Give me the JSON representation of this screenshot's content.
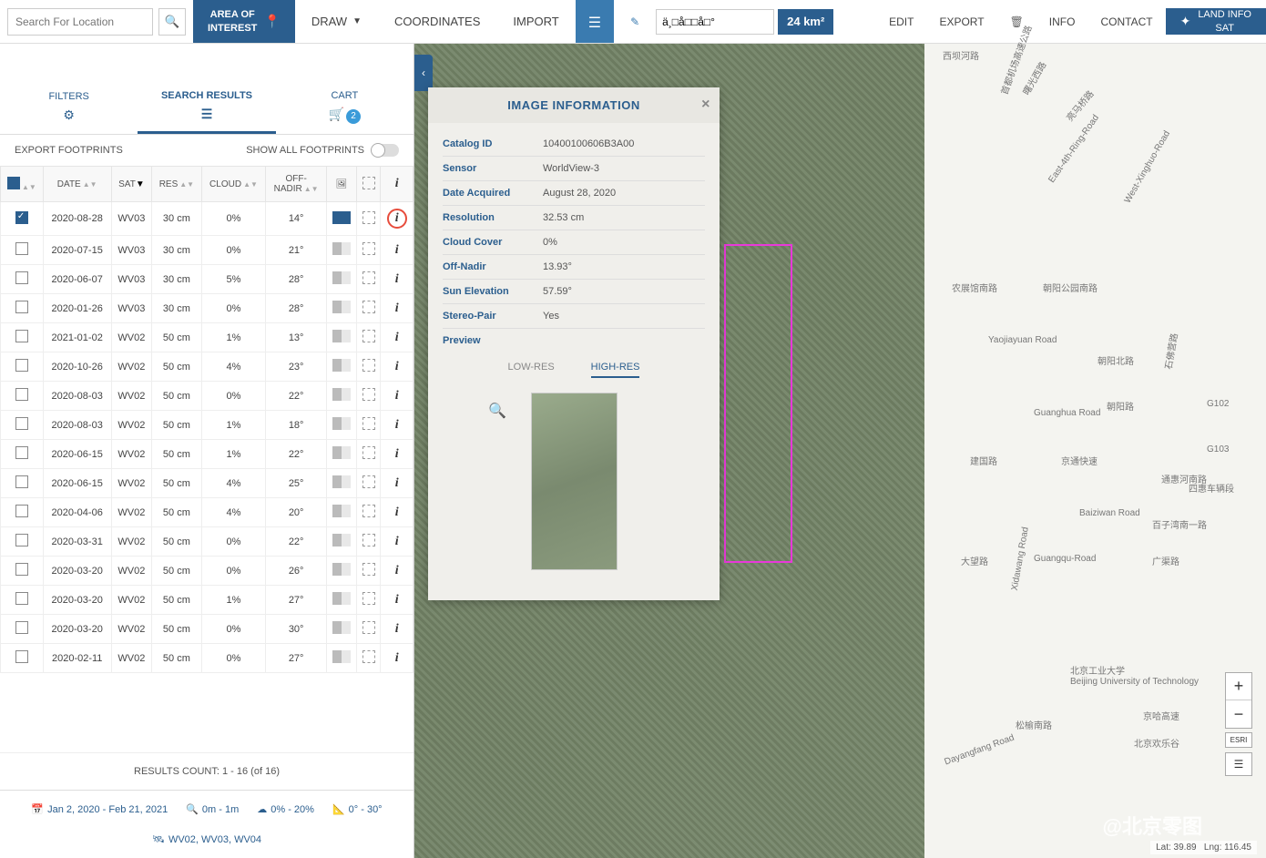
{
  "search": {
    "placeholder": "Search For Location"
  },
  "toolbar": {
    "aoi": "AREA OF\nINTEREST",
    "draw": "DRAW",
    "coordinates": "COORDINATES",
    "import": "IMPORT",
    "polygons": "POLYGONS",
    "polygon_name": "ä¸□å□□å□°",
    "area": "24 km²",
    "edit": "EDIT",
    "export": "EXPORT",
    "info": "INFO",
    "contact": "CONTACT",
    "land_info": "LAND INFO\nSAT"
  },
  "tabs": {
    "filters": "FILTERS",
    "results": "SEARCH RESULTS",
    "cart": "CART",
    "cart_count": "2"
  },
  "footprints": {
    "export": "EXPORT FOOTPRINTS",
    "show_all": "SHOW ALL FOOTPRINTS"
  },
  "headers": {
    "date": "DATE",
    "sat": "SAT",
    "res": "RES",
    "cloud": "CLOUD",
    "off_nadir": "OFF-\nNADIR"
  },
  "rows": [
    {
      "checked": true,
      "date": "2020-08-28",
      "sat": "WV03",
      "res": "30 cm",
      "cloud": "0%",
      "nadir": "14°",
      "on": true,
      "circled": true
    },
    {
      "checked": false,
      "date": "2020-07-15",
      "sat": "WV03",
      "res": "30 cm",
      "cloud": "0%",
      "nadir": "21°",
      "on": false
    },
    {
      "checked": false,
      "date": "2020-06-07",
      "sat": "WV03",
      "res": "30 cm",
      "cloud": "5%",
      "nadir": "28°",
      "on": false
    },
    {
      "checked": false,
      "date": "2020-01-26",
      "sat": "WV03",
      "res": "30 cm",
      "cloud": "0%",
      "nadir": "28°",
      "on": false
    },
    {
      "checked": false,
      "date": "2021-01-02",
      "sat": "WV02",
      "res": "50 cm",
      "cloud": "1%",
      "nadir": "13°",
      "on": false
    },
    {
      "checked": false,
      "date": "2020-10-26",
      "sat": "WV02",
      "res": "50 cm",
      "cloud": "4%",
      "nadir": "23°",
      "on": false
    },
    {
      "checked": false,
      "date": "2020-08-03",
      "sat": "WV02",
      "res": "50 cm",
      "cloud": "0%",
      "nadir": "22°",
      "on": false
    },
    {
      "checked": false,
      "date": "2020-08-03",
      "sat": "WV02",
      "res": "50 cm",
      "cloud": "1%",
      "nadir": "18°",
      "on": false
    },
    {
      "checked": false,
      "date": "2020-06-15",
      "sat": "WV02",
      "res": "50 cm",
      "cloud": "1%",
      "nadir": "22°",
      "on": false
    },
    {
      "checked": false,
      "date": "2020-06-15",
      "sat": "WV02",
      "res": "50 cm",
      "cloud": "4%",
      "nadir": "25°",
      "on": false
    },
    {
      "checked": false,
      "date": "2020-04-06",
      "sat": "WV02",
      "res": "50 cm",
      "cloud": "4%",
      "nadir": "20°",
      "on": false
    },
    {
      "checked": false,
      "date": "2020-03-31",
      "sat": "WV02",
      "res": "50 cm",
      "cloud": "0%",
      "nadir": "22°",
      "on": false
    },
    {
      "checked": false,
      "date": "2020-03-20",
      "sat": "WV02",
      "res": "50 cm",
      "cloud": "0%",
      "nadir": "26°",
      "on": false
    },
    {
      "checked": false,
      "date": "2020-03-20",
      "sat": "WV02",
      "res": "50 cm",
      "cloud": "1%",
      "nadir": "27°",
      "on": false
    },
    {
      "checked": false,
      "date": "2020-03-20",
      "sat": "WV02",
      "res": "50 cm",
      "cloud": "0%",
      "nadir": "30°",
      "on": false
    },
    {
      "checked": false,
      "date": "2020-02-11",
      "sat": "WV02",
      "res": "50 cm",
      "cloud": "0%",
      "nadir": "27°",
      "on": false
    }
  ],
  "results_count": {
    "label": "RESULTS COUNT:",
    "value": "1 - 16  (of 16)"
  },
  "filters_summary": {
    "date_range": "Jan 2, 2020 - Feb 21, 2021",
    "res_range": "0m - 1m",
    "cloud_range": "0% - 20%",
    "nadir_range": "0° - 30°",
    "sats": "WV02, WV03, WV04"
  },
  "popup": {
    "title": "IMAGE INFORMATION",
    "rows": [
      {
        "k": "Catalog ID",
        "v": "10400100606B3A00"
      },
      {
        "k": "Sensor",
        "v": "WorldView-3"
      },
      {
        "k": "Date Acquired",
        "v": "August 28, 2020"
      },
      {
        "k": "Resolution",
        "v": "32.53 cm"
      },
      {
        "k": "Cloud Cover",
        "v": "0%"
      },
      {
        "k": "Off-Nadir",
        "v": "13.93°"
      },
      {
        "k": "Sun Elevation",
        "v": "57.59°"
      },
      {
        "k": "Stereo-Pair",
        "v": "Yes"
      }
    ],
    "preview": "Preview",
    "lowres": "LOW-RES",
    "highres": "HIGH-RES"
  },
  "map": {
    "lat": "Lat: 39.89",
    "lng": "Lng: 116.45",
    "watermark": "@北京零图",
    "esri": "ESRI",
    "roads": [
      "西坝河路",
      "首都机场高速公路",
      "曙光西路",
      "亮马桥路",
      "East-4th-Ring-Road",
      "West-Xinghuo-Road",
      "农展馆南路",
      "朝阳公园南路",
      "Yaojiayuan Road",
      "朝阳北路",
      "石佛营路",
      "朝阳路",
      "Guanghua Road",
      "G102",
      "建国路",
      "京通快速",
      "G103",
      "通惠河南路",
      "四惠车辆段",
      "Baiziwan Road",
      "百子湾南一路",
      "大望路",
      "Xidawang Road",
      "Guangqu-Road",
      "广渠路",
      "北京工业大学",
      "Beijing University of Technology",
      "京哈高速",
      "北京欢乐谷",
      "Dayangfang Road",
      "松榆南路"
    ]
  }
}
